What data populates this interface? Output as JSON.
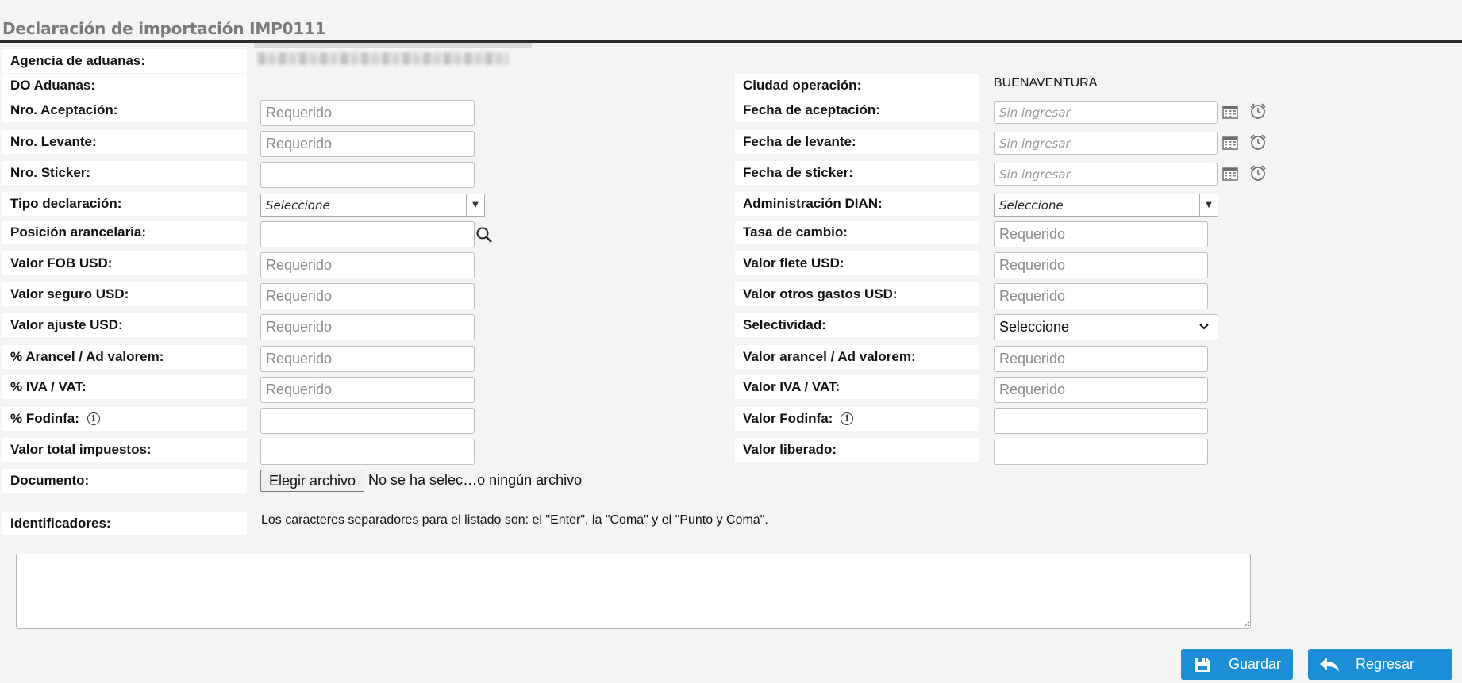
{
  "page": {
    "title": "Declaración de importación IMP0111"
  },
  "header": {
    "blurred_value": ""
  },
  "left": {
    "agencia": "Agencia de aduanas:",
    "do_aduanas": "DO Aduanas:",
    "nro_aceptacion": "Nro. Aceptación:",
    "nro_levante": "Nro. Levante:",
    "nro_sticker": "Nro. Sticker:",
    "tipo_declaracion": "Tipo declaración:",
    "posicion_arancelaria": "Posición arancelaria:",
    "valor_fob": "Valor FOB USD:",
    "valor_seguro": "Valor seguro USD:",
    "valor_ajuste": "Valor ajuste USD:",
    "arancel": "% Arancel / Ad valorem:",
    "iva": "% IVA / VAT:",
    "fodinfa": "% Fodinfa:",
    "total_impuestos": "Valor total impuestos:",
    "documento": "Documento:",
    "identificadores": "Identificadores:"
  },
  "right": {
    "ciudad_operacion": "Ciudad operación:",
    "ciudad_value": "BUENAVENTURA",
    "fecha_aceptacion": "Fecha de aceptación:",
    "fecha_levante": "Fecha de levante:",
    "fecha_sticker": "Fecha de sticker:",
    "administracion_dian": "Administración DIAN:",
    "tasa_cambio": "Tasa de cambio:",
    "valor_flete": "Valor flete USD:",
    "valor_otros_gastos": "Valor otros gastos USD:",
    "selectividad": "Selectividad:",
    "valor_arancel": "Valor arancel / Ad valorem:",
    "valor_iva": "Valor IVA / VAT:",
    "valor_fodinfa": "Valor Fodinfa:",
    "valor_liberado": "Valor liberado:"
  },
  "placeholders": {
    "required": "Requerido",
    "date": "Sin ingresar"
  },
  "selects": {
    "tipo_declaracion": "Seleccione",
    "administracion_dian": "Seleccione",
    "selectividad": "Seleccione"
  },
  "file": {
    "button": "Elegir archivo",
    "status": "No se ha selec…o ningún archivo"
  },
  "hint": "Los caracteres separadores para el listado son: el \"Enter\", la \"Coma\" y el \"Punto y Coma\".",
  "actions": {
    "save": "Guardar",
    "back": "Regresar"
  },
  "icons": {
    "calendar": "calendar-icon",
    "clock": "clock-icon",
    "search": "search-icon",
    "info": "info-icon",
    "save": "floppy-icon",
    "back": "reply-arrow-icon"
  },
  "colors": {
    "primary": "#1b8ed8",
    "title": "#7a7a7a",
    "rule": "#2b2b2b"
  }
}
